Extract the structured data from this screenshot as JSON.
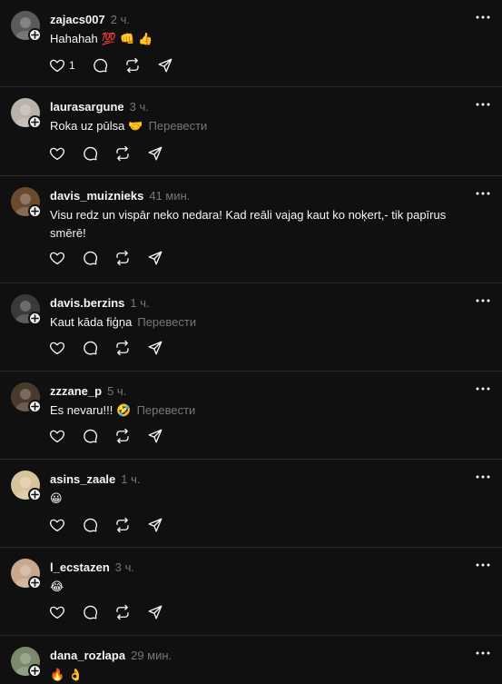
{
  "translate_label": "Перевести",
  "posts": [
    {
      "username": "zajacs007",
      "time": "2 ч.",
      "text": "Hahahah",
      "emoji": "💯 👊 👍",
      "translate": "",
      "like_count": "1",
      "avatar_color": "#5a5a5a"
    },
    {
      "username": "laurasargune",
      "time": "3 ч.",
      "text": "Roka uz pūlsa",
      "emoji": "🤝",
      "translate": "Перевести",
      "like_count": "",
      "avatar_color": "#b9b3aa"
    },
    {
      "username": "davis_muiznieks",
      "time": "41 мин.",
      "text": "Visu redz un vispār neko nedara! Kad reāli vajag kaut ko noķert,- tik papīrus smērē!",
      "emoji": "",
      "translate": "",
      "like_count": "",
      "avatar_color": "#6b4b2e"
    },
    {
      "username": "davis.berzins",
      "time": "1 ч.",
      "text": "Kaut kāda fiģņa",
      "emoji": "",
      "translate": "Перевести",
      "like_count": "",
      "avatar_color": "#3a3a3a"
    },
    {
      "username": "zzzane_p",
      "time": "5 ч.",
      "text": "Es nevaru!!!",
      "emoji": "🤣",
      "translate": "Перевести",
      "like_count": "",
      "avatar_color": "#4a3a2c"
    },
    {
      "username": "asins_zaale",
      "time": "1 ч.",
      "text": "",
      "emoji": "😀",
      "translate": "",
      "like_count": "",
      "avatar_color": "#d8c49a"
    },
    {
      "username": "l_ecstazen",
      "time": "3 ч.",
      "text": "",
      "emoji": "😂",
      "translate": "",
      "like_count": "",
      "avatar_color": "#c9a98d"
    },
    {
      "username": "dana_rozlapa",
      "time": "29 мин.",
      "text": "",
      "emoji": "🔥 👌",
      "translate": "",
      "like_count": "",
      "avatar_color": "#7b8a6a"
    }
  ],
  "colors": {
    "background": "#101010",
    "text": "#f3f5f7",
    "muted": "#777777",
    "divider": "#2a2a2a"
  },
  "icons": [
    "add-follow-icon",
    "more-icon",
    "heart-icon",
    "comment-icon",
    "repost-icon",
    "share-icon"
  ]
}
